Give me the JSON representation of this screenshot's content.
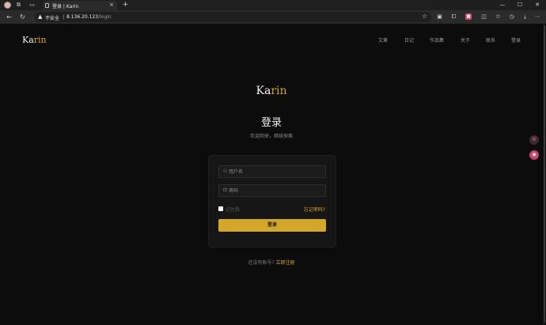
{
  "browser": {
    "tab": {
      "title": "登录 | Karin",
      "close_glyph": "×"
    },
    "new_tab_glyph": "+",
    "address": {
      "security_label": "不安全",
      "host": "8.136.20.123",
      "path": "/login"
    },
    "window_controls": {
      "minimize": "—",
      "maximize": "☐",
      "close": "✕"
    }
  },
  "site": {
    "logo_main": "Ka",
    "logo_accent": "rin",
    "nav": [
      "文章",
      "日记",
      "作品集",
      "关于",
      "联系",
      "登录"
    ]
  },
  "login": {
    "logo_main": "Ka",
    "logo_accent": "rin",
    "heading": "登录",
    "subheading": "欢迎回来，继续探索",
    "username_placeholder": "用户名",
    "password_placeholder": "密码",
    "remember_label": "记住我",
    "forgot_label": "忘记密码?",
    "submit_label": "登录",
    "signup_prompt": "还没有账号?",
    "signup_link": "立即注册"
  },
  "colors": {
    "accent": "#d4a62a",
    "background": "#0c0c0c",
    "card": "#161616"
  }
}
